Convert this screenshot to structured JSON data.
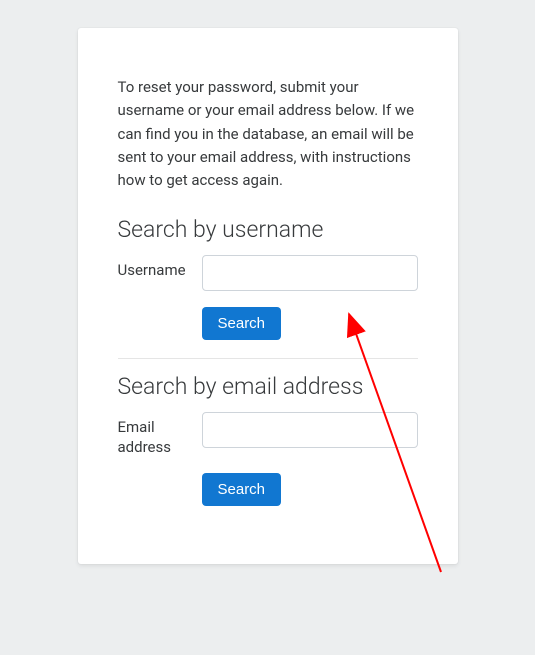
{
  "intro": "To reset your password, submit your username or your email address below. If we can find you in the database, an email will be sent to your email address, with instructions how to get access again.",
  "username_section": {
    "heading": "Search by username",
    "label": "Username",
    "value": "",
    "button": "Search"
  },
  "email_section": {
    "heading": "Search by email address",
    "label": "Email address",
    "value": "",
    "button": "Search"
  }
}
